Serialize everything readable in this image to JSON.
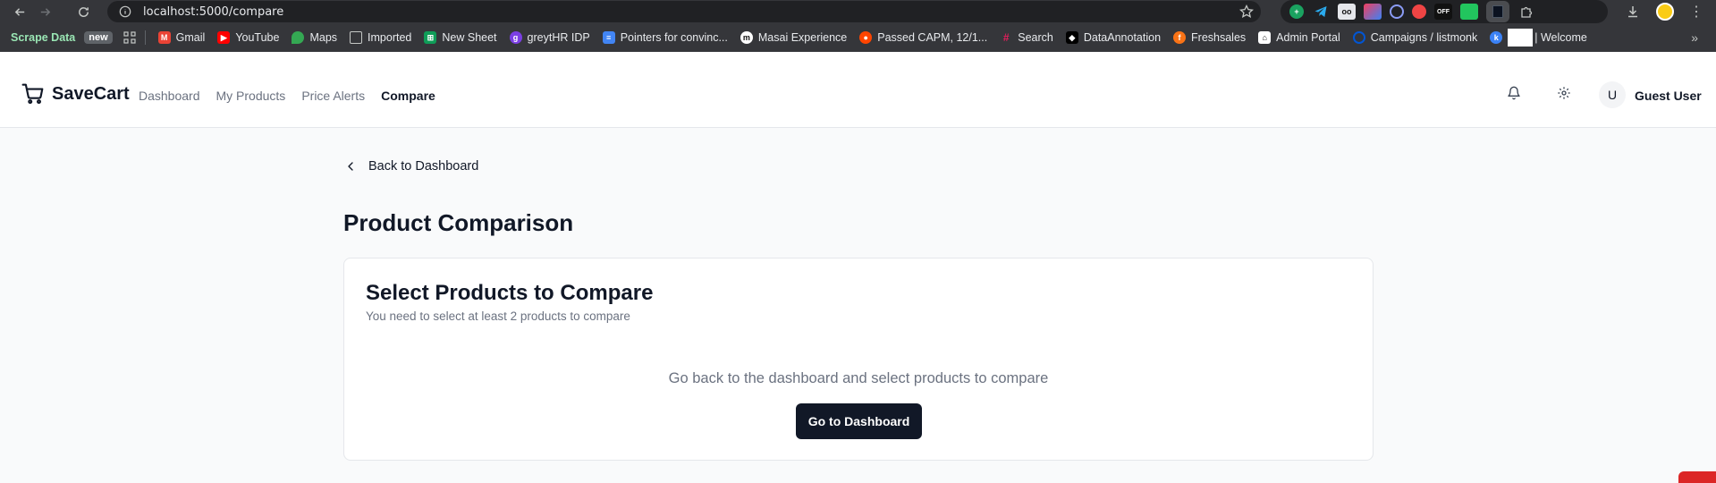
{
  "browser": {
    "url": "localhost:5000/compare",
    "bookmarks": [
      {
        "label": "Scrape Data",
        "icon": "none",
        "color": ""
      },
      {
        "label": "new",
        "icon": "badge",
        "color": ""
      },
      {
        "label": "Gmail",
        "icon": "gmail-icon",
        "color": "#ea4335"
      },
      {
        "label": "YouTube",
        "icon": "youtube-icon",
        "color": "#ff0000"
      },
      {
        "label": "Maps",
        "icon": "maps-icon",
        "color": "#34a853"
      },
      {
        "label": "Imported",
        "icon": "folder-icon",
        "color": ""
      },
      {
        "label": "New Sheet",
        "icon": "sheets-icon",
        "color": "#0f9d58"
      },
      {
        "label": "greytHR IDP",
        "icon": "greythr-icon",
        "color": "#7b3fe4"
      },
      {
        "label": "Pointers for convinc...",
        "icon": "docs-icon",
        "color": "#4285f4"
      },
      {
        "label": "Masai Experience",
        "icon": "masai-icon",
        "color": "#ffffff"
      },
      {
        "label": "Passed CAPM, 12/1...",
        "icon": "reddit-icon",
        "color": "#ff4500"
      },
      {
        "label": "Search",
        "icon": "slack-icon",
        "color": "#e01e5a"
      },
      {
        "label": "DataAnnotation",
        "icon": "dataannotation-icon",
        "color": "#000000"
      },
      {
        "label": "Freshsales",
        "icon": "freshsales-icon",
        "color": "#f97316"
      },
      {
        "label": "Admin Portal",
        "icon": "admin-icon",
        "color": "#ffffff"
      },
      {
        "label": "Campaigns / listmonk",
        "icon": "listmonk-icon",
        "color": "#0055d4"
      },
      {
        "label": "| Welcome",
        "icon": "k-icon",
        "color": "#3b82f6"
      }
    ]
  },
  "header": {
    "brand": "SaveCart",
    "nav": [
      "Dashboard",
      "My Products",
      "Price Alerts",
      "Compare"
    ],
    "active_nav": "Compare",
    "avatar_initial": "U",
    "user_name": "Guest User"
  },
  "main": {
    "back_label": "Back to Dashboard",
    "page_title": "Product Comparison",
    "card": {
      "title": "Select Products to Compare",
      "subtitle": "You need to select at least 2 products to compare",
      "empty_message": "Go back to the dashboard and select products to compare",
      "button_label": "Go to Dashboard"
    }
  },
  "colors": {
    "primary": "#111827",
    "muted_text": "#6b7280",
    "page_bg": "#f9fafb",
    "border": "#e5e7eb"
  }
}
